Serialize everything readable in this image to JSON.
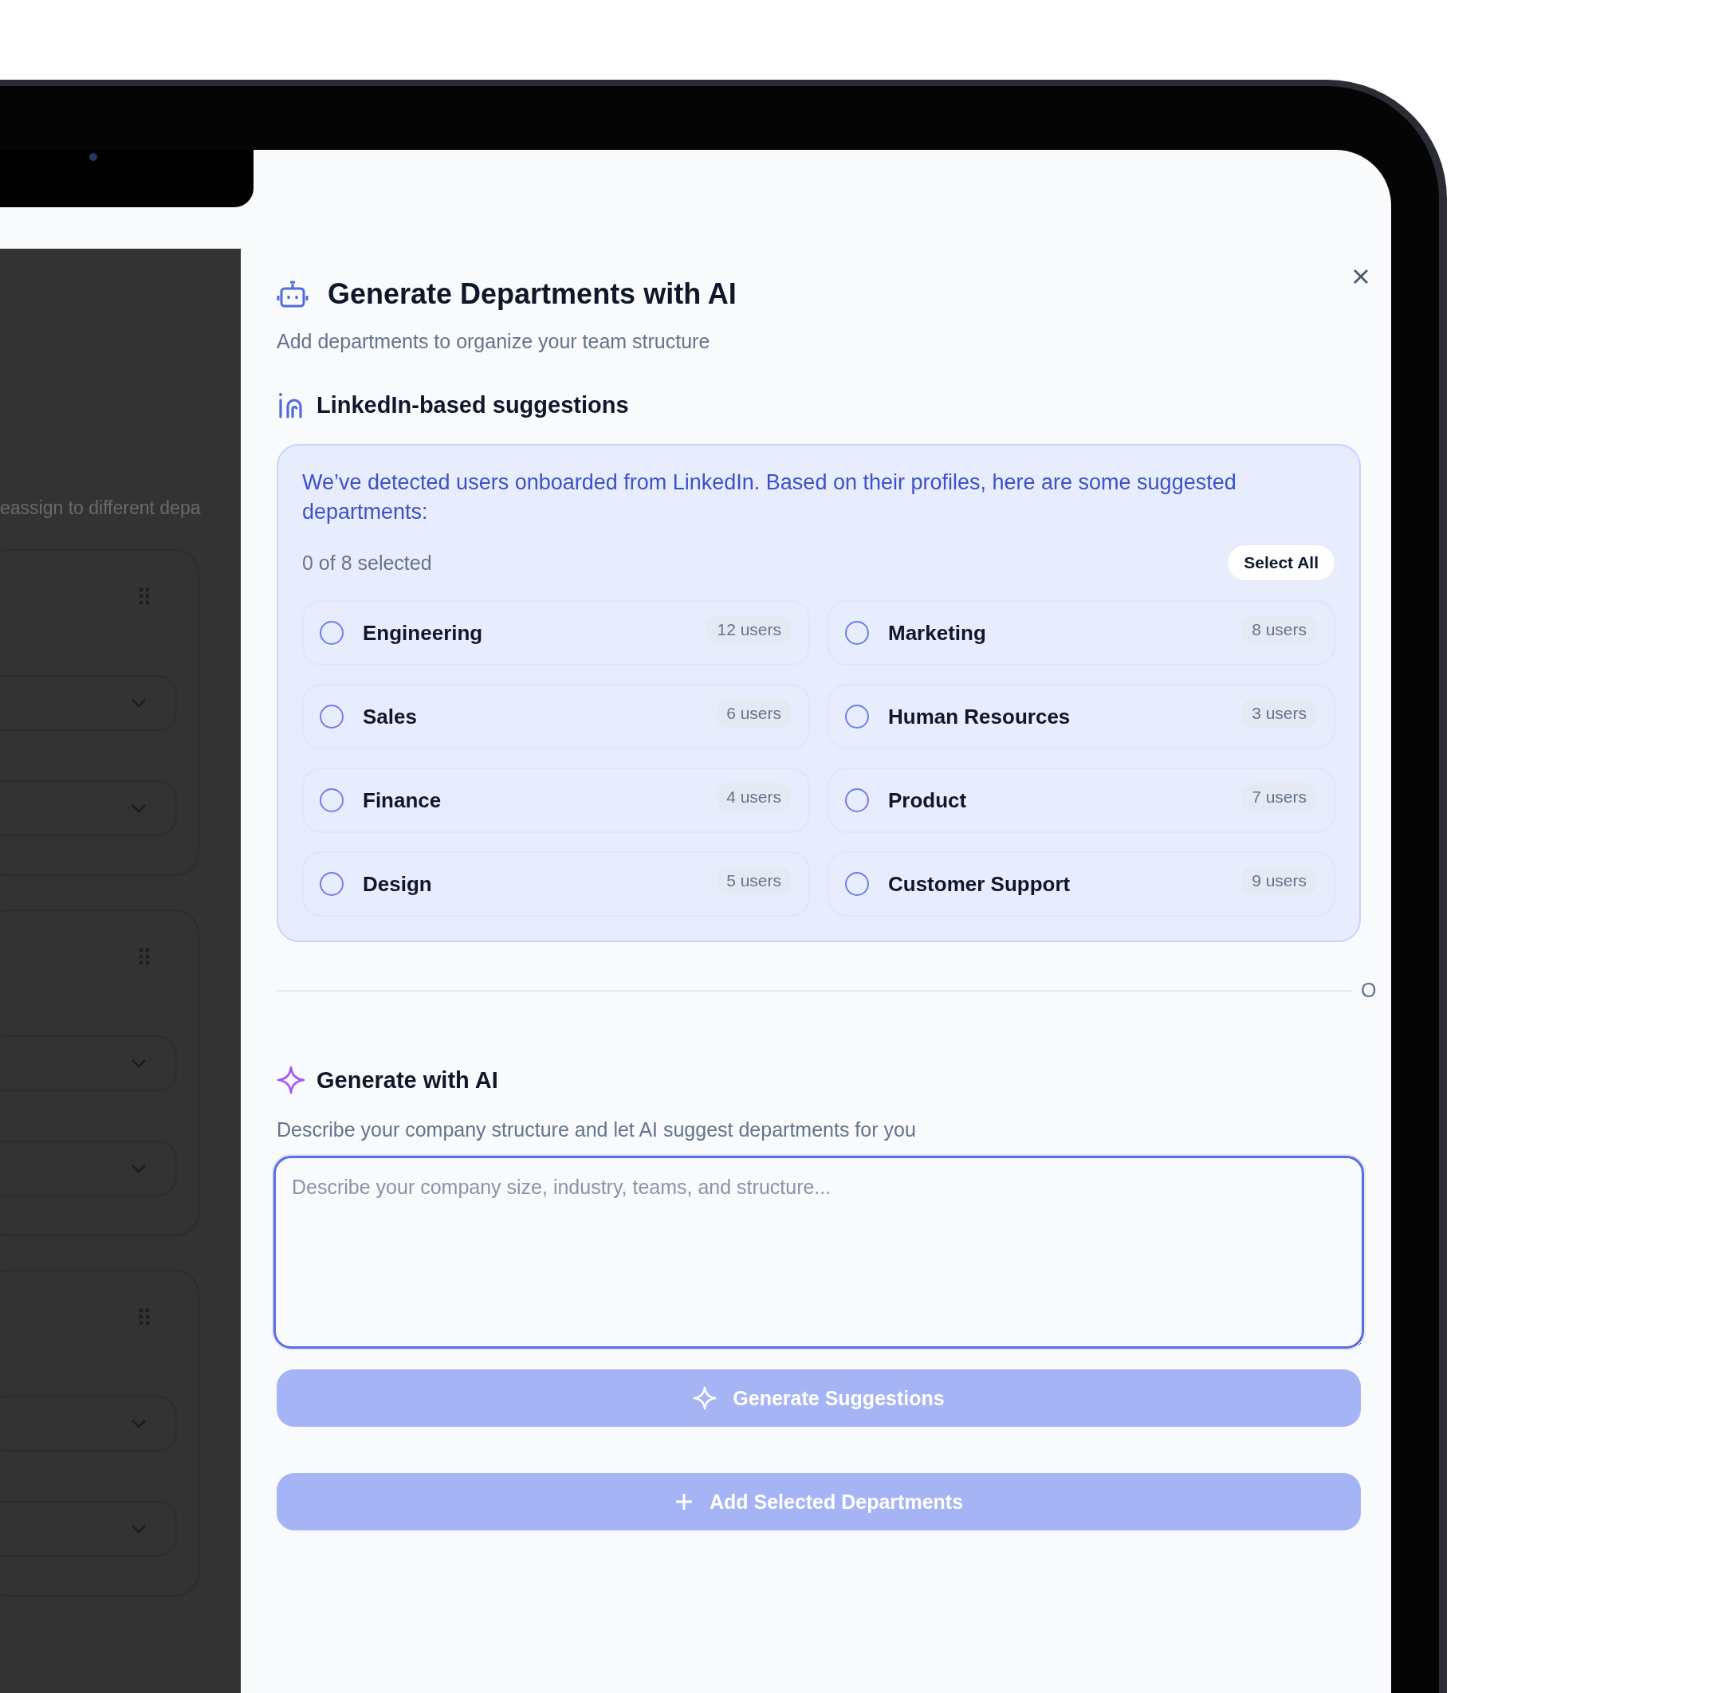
{
  "background_page": {
    "text": "eassign to different depa"
  },
  "dialog": {
    "title": "Generate Departments with AI",
    "subtitle": "Add departments to organize your team structure"
  },
  "linkedin_section": {
    "heading": "LinkedIn-based suggestions",
    "notice": "We’ve detected users onboarded from LinkedIn. Based on their profiles, here are some suggested departments:",
    "selection_count": "0 of 8 selected",
    "select_all_button": "Select All",
    "departments": [
      {
        "name": "Engineering",
        "count": "12 users",
        "selected": false
      },
      {
        "name": "Marketing",
        "count": "8 users",
        "selected": false
      },
      {
        "name": "Sales",
        "count": "6 users",
        "selected": false
      },
      {
        "name": "Human Resources",
        "count": "3 users",
        "selected": false
      },
      {
        "name": "Finance",
        "count": "4 users",
        "selected": false
      },
      {
        "name": "Product",
        "count": "7 users",
        "selected": false
      },
      {
        "name": "Design",
        "count": "5 users",
        "selected": false
      },
      {
        "name": "Customer Support",
        "count": "9 users",
        "selected": false
      }
    ]
  },
  "divider_label": "O",
  "ai_section": {
    "heading": "Generate with AI",
    "description": "Describe your company structure and let AI suggest departments for you",
    "input": {
      "placeholder": "Describe your company size, industry, teams, and structure...",
      "focused": true
    },
    "generate_button": {
      "label": "Generate Suggestions",
      "disabled": true
    }
  },
  "add_button": {
    "label": "Add Selected Departments",
    "disabled": true
  }
}
